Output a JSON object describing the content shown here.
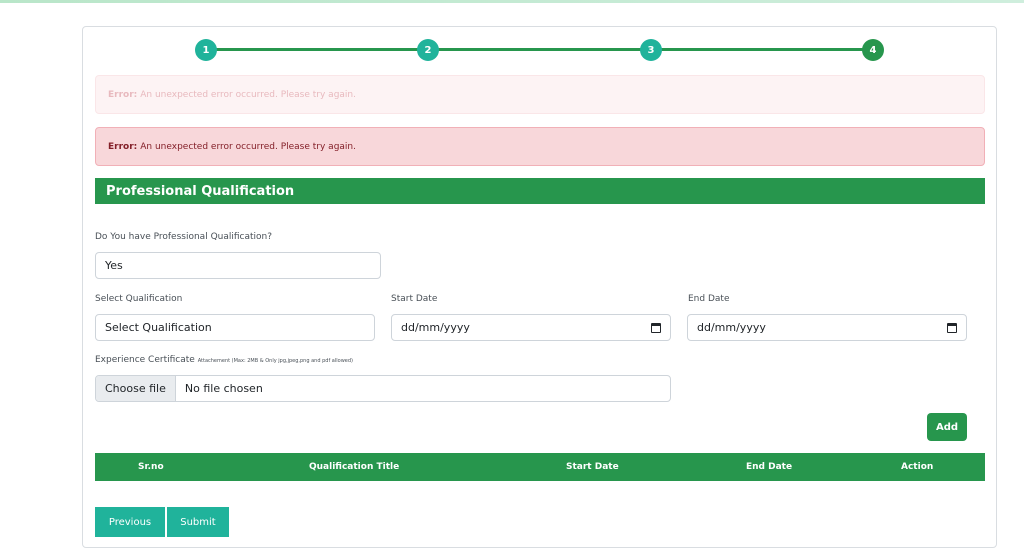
{
  "stepper": {
    "steps": [
      "1",
      "2",
      "3",
      "4"
    ]
  },
  "alerts": [
    {
      "label": "Error:",
      "message": "An unexpected error occurred. Please try again."
    },
    {
      "label": "Error:",
      "message": "An unexpected error occurred. Please try again."
    }
  ],
  "section": {
    "title": "Professional Qualification"
  },
  "form": {
    "has_qualification_label": "Do You have Professional Qualification?",
    "has_qualification_value": "Yes",
    "qualification_label": "Select Qualification",
    "qualification_value": "Select Qualification",
    "start_date_label": "Start Date",
    "start_date_value": "dd/mm/yyyy",
    "end_date_label": "End Date",
    "end_date_value": "dd/mm/yyyy",
    "certificate_label": "Experience Certificate",
    "certificate_hint": "Attachement (Max: 2MB & Only jpg,jpeg,png and pdf allowed)",
    "file_button": "Choose file",
    "file_status": "No file chosen",
    "add_button": "Add"
  },
  "table": {
    "headers": [
      "Sr.no",
      "Qualification Title",
      "Start Date",
      "End Date",
      "Action"
    ]
  },
  "footer": {
    "previous": "Previous",
    "submit": "Submit"
  },
  "colors": {
    "green": "#27964d",
    "teal": "#20b39b",
    "error_bg": "#f8d7da",
    "error_text": "#842029"
  }
}
